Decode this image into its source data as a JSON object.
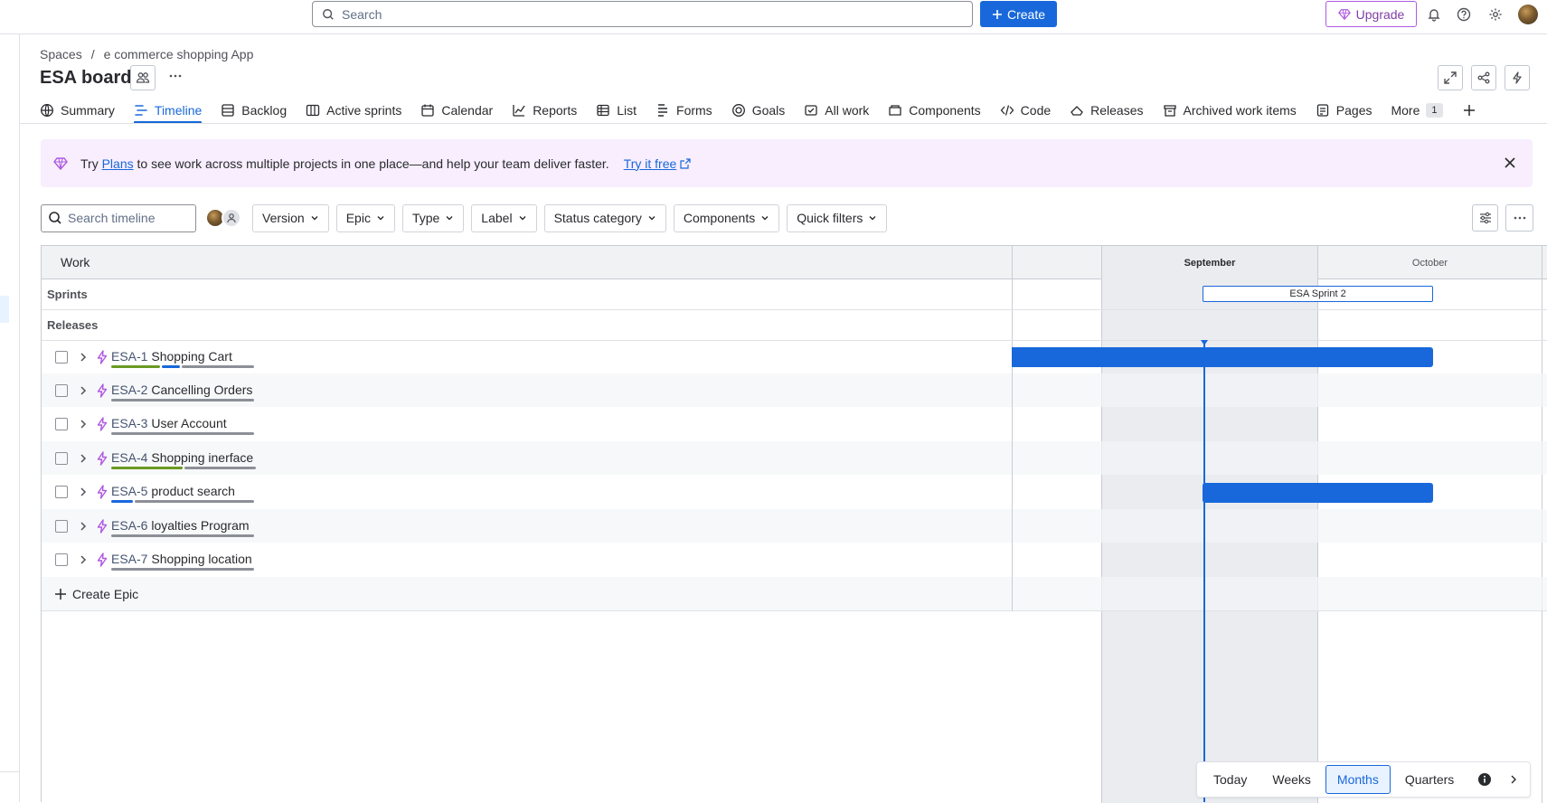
{
  "topbar": {
    "search_placeholder": "Search",
    "create_label": "Create",
    "upgrade_label": "Upgrade"
  },
  "breadcrumb": {
    "spaces": "Spaces",
    "separator": "/",
    "project": "e commerce shopping App"
  },
  "board": {
    "title": "ESA board"
  },
  "tabs": [
    {
      "label": "Summary",
      "icon": "globe-icon"
    },
    {
      "label": "Timeline",
      "icon": "timeline-icon",
      "active": true
    },
    {
      "label": "Backlog",
      "icon": "backlog-icon"
    },
    {
      "label": "Active sprints",
      "icon": "board-icon"
    },
    {
      "label": "Calendar",
      "icon": "calendar-icon"
    },
    {
      "label": "Reports",
      "icon": "chart-icon"
    },
    {
      "label": "List",
      "icon": "list-icon"
    },
    {
      "label": "Forms",
      "icon": "forms-icon"
    },
    {
      "label": "Goals",
      "icon": "target-icon"
    },
    {
      "label": "All work",
      "icon": "work-icon"
    },
    {
      "label": "Components",
      "icon": "component-icon"
    },
    {
      "label": "Code",
      "icon": "code-icon"
    },
    {
      "label": "Releases",
      "icon": "ship-icon"
    },
    {
      "label": "Archived work items",
      "icon": "archive-icon"
    },
    {
      "label": "Pages",
      "icon": "page-icon"
    }
  ],
  "more": {
    "label": "More",
    "count": "1"
  },
  "banner": {
    "try": "Try",
    "plans_link": "Plans",
    "text": "to see work across multiple projects in one place—and help your team deliver faster.",
    "cta": "Try it free"
  },
  "filters": {
    "search_placeholder": "Search timeline",
    "buttons": [
      "Version",
      "Epic",
      "Type",
      "Label",
      "Status category",
      "Components",
      "Quick filters"
    ]
  },
  "timeline": {
    "work_header": "Work",
    "sprints_label": "Sprints",
    "releases_label": "Releases",
    "months": [
      "September",
      "October"
    ],
    "sprint_name": "ESA Sprint 2",
    "create_epic": "Create Epic",
    "epics": [
      {
        "key": "ESA-1",
        "name": "Shopping Cart"
      },
      {
        "key": "ESA-2",
        "name": "Cancelling Orders"
      },
      {
        "key": "ESA-3",
        "name": "User Account"
      },
      {
        "key": "ESA-4",
        "name": "Shopping inerface"
      },
      {
        "key": "ESA-5",
        "name": "product search"
      },
      {
        "key": "ESA-6",
        "name": "loyalties Program"
      },
      {
        "key": "ESA-7",
        "name": "Shopping location"
      }
    ]
  },
  "viewbar": {
    "options": [
      "Today",
      "Weeks",
      "Months",
      "Quarters"
    ],
    "selected": "Months"
  },
  "colors": {
    "accent": "#1868db",
    "done": "#6a9a23",
    "in_progress": "#1868db",
    "todo": "#8c8f97",
    "epic_icon": "#af59e1"
  }
}
